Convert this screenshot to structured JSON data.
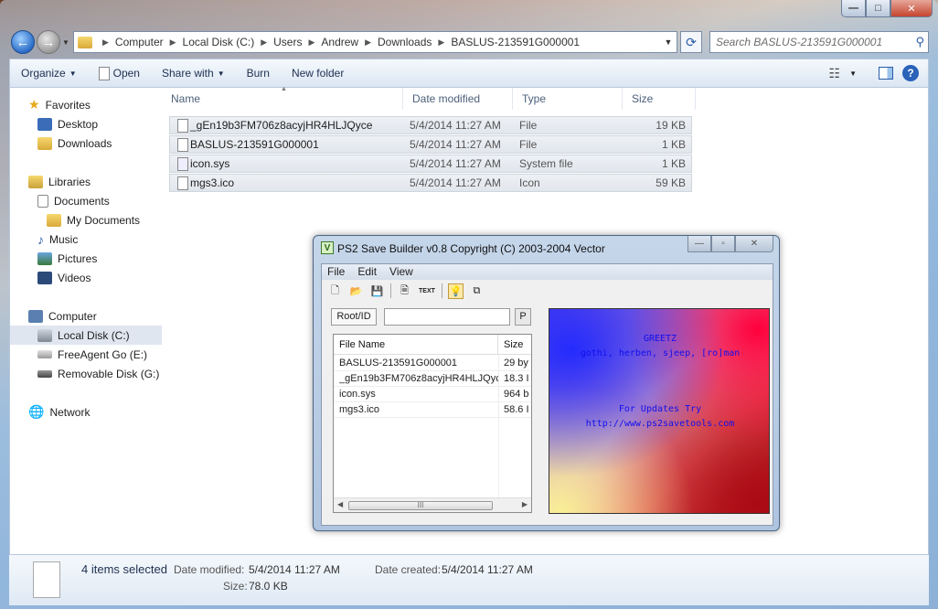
{
  "caption": {
    "minimize": "—",
    "maximize": "□",
    "close": "✕"
  },
  "address": {
    "crumbs": [
      "Computer",
      "Local Disk (C:)",
      "Users",
      "Andrew",
      "Downloads",
      "BASLUS-213591G000001"
    ],
    "search_placeholder": "Search BASLUS-213591G000001"
  },
  "toolbar": {
    "organize": "Organize",
    "open": "Open",
    "share_with": "Share with",
    "burn": "Burn",
    "new_folder": "New folder"
  },
  "nav": {
    "favorites": "Favorites",
    "desktop": "Desktop",
    "downloads": "Downloads",
    "libraries": "Libraries",
    "documents": "Documents",
    "my_documents": "My Documents",
    "music": "Music",
    "pictures": "Pictures",
    "videos": "Videos",
    "computer": "Computer",
    "local_disk": "Local Disk (C:)",
    "freeagent": "FreeAgent Go (E:)",
    "removable": "Removable Disk (G:)",
    "network": "Network"
  },
  "columns": {
    "name": "Name",
    "date": "Date modified",
    "type": "Type",
    "size": "Size"
  },
  "files": [
    {
      "name": "_gEn19b3FM706z8acyjHR4HLJQyce",
      "date": "5/4/2014 11:27 AM",
      "type": "File",
      "size": "19 KB"
    },
    {
      "name": "BASLUS-213591G000001",
      "date": "5/4/2014 11:27 AM",
      "type": "File",
      "size": "1 KB"
    },
    {
      "name": "icon.sys",
      "date": "5/4/2014 11:27 AM",
      "type": "System file",
      "size": "1 KB"
    },
    {
      "name": "mgs3.ico",
      "date": "5/4/2014 11:27 AM",
      "type": "Icon",
      "size": "59 KB"
    }
  ],
  "status": {
    "selected": "4 items selected",
    "date_modified_label": "Date modified:",
    "date_modified": "5/4/2014 11:27 AM",
    "date_created_label": "Date created:",
    "date_created": "5/4/2014 11:27 AM",
    "size_label": "Size:",
    "size": "78.0 KB"
  },
  "ps2": {
    "title": "PS2 Save Builder v0.8 Copyright (C) 2003-2004 Vector",
    "logo": "V",
    "menu": [
      "File",
      "Edit",
      "View"
    ],
    "text_tool": "TEXT",
    "root_tab": "Root/ID",
    "p_button": "P",
    "list_headers": {
      "name": "File Name",
      "size": "Size"
    },
    "list": [
      {
        "name": "BASLUS-213591G000001",
        "size": "29 by"
      },
      {
        "name": "_gEn19b3FM706z8acyjHR4HLJQyce",
        "size": "18.3 I"
      },
      {
        "name": "icon.sys",
        "size": "964 b"
      },
      {
        "name": "mgs3.ico",
        "size": "58.6 I"
      }
    ],
    "scroll_grip": "III",
    "canvas": {
      "greetz": "GREETZ",
      "names": "gothi, herben, sjeep, [ro]man",
      "updates": "For Updates Try",
      "url": "http://www.ps2savetools.com"
    }
  }
}
